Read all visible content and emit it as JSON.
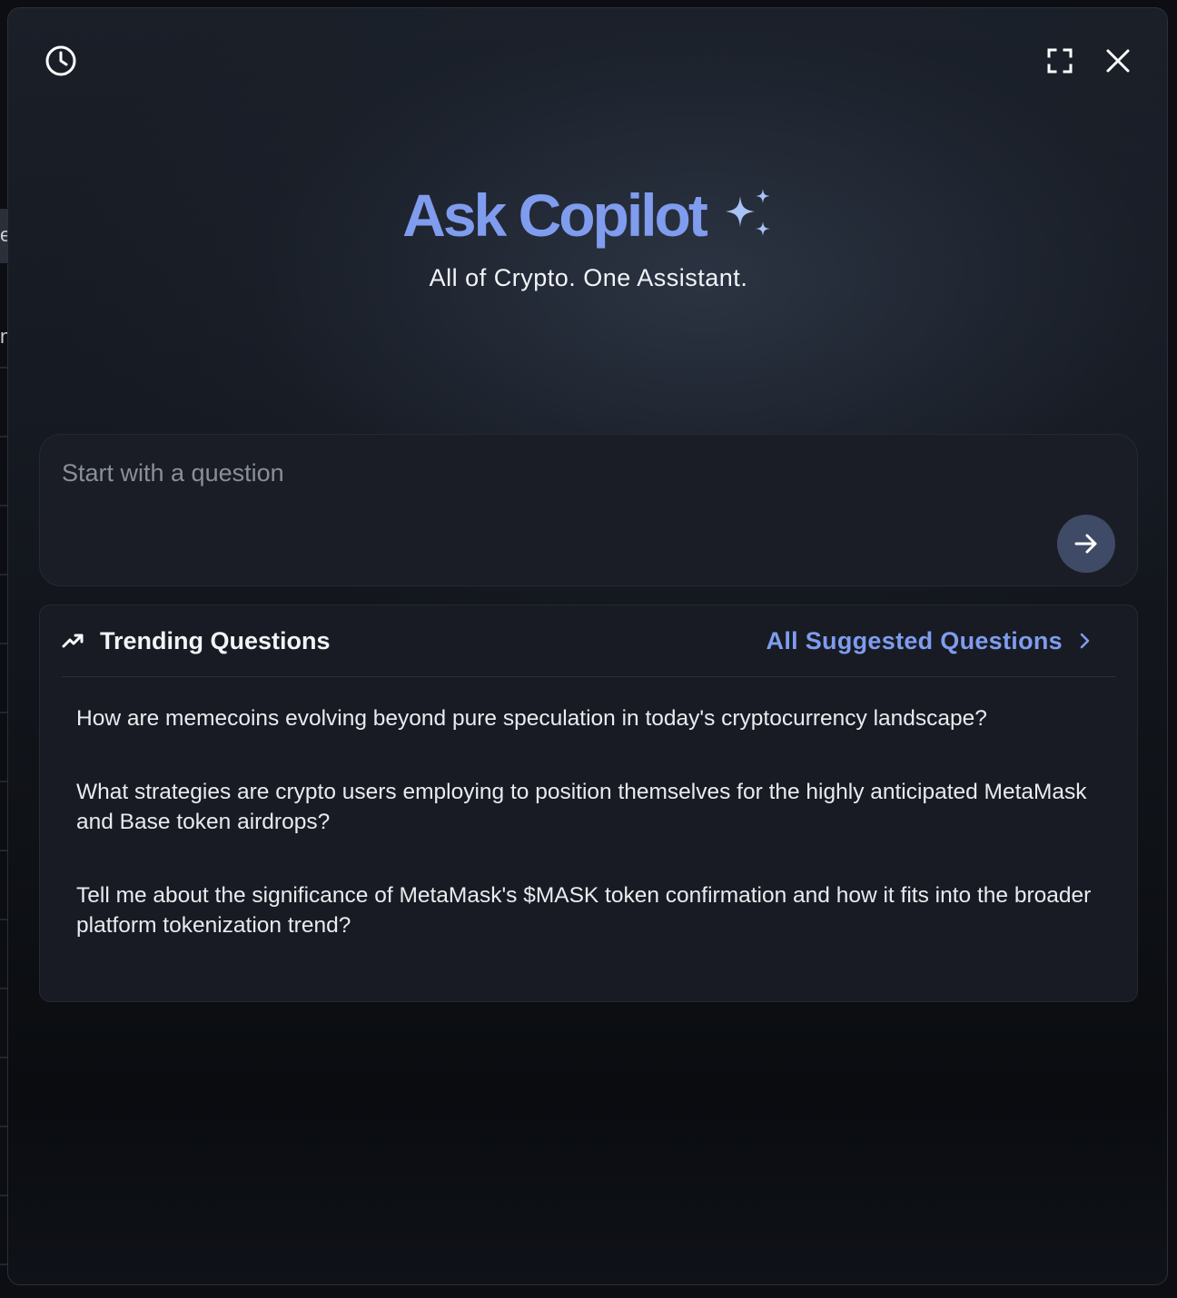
{
  "background": {
    "fragments": [
      "e",
      "n"
    ]
  },
  "header": {
    "history_icon": "clock-icon",
    "expand_icon": "fullscreen-icon",
    "close_icon": "close-icon"
  },
  "hero": {
    "title": "Ask Copilot",
    "subtitle": "All of Crypto. One Assistant.",
    "sparkle_icon": "sparkles-icon"
  },
  "question": {
    "placeholder": "Start with a question",
    "value": "",
    "send_icon": "arrow-right-icon"
  },
  "trending": {
    "icon": "trending-up-icon",
    "title": "Trending Questions",
    "link_label": "All Suggested Questions",
    "link_icon": "chevron-right-icon",
    "items": [
      {
        "text": "How are memecoins evolving beyond pure speculation in today's cryptocurrency landscape?"
      },
      {
        "text": "What strategies are crypto users employing to position themselves for the highly anticipated MetaMask and Base token airdrops?"
      },
      {
        "text": "Tell me about the significance of MetaMask's $MASK token confirmation and how it fits into the broader platform tokenization trend?"
      }
    ]
  },
  "colors": {
    "accent": "#7f9cee",
    "send_button": "#3e4a66",
    "panel": "#181b23"
  }
}
